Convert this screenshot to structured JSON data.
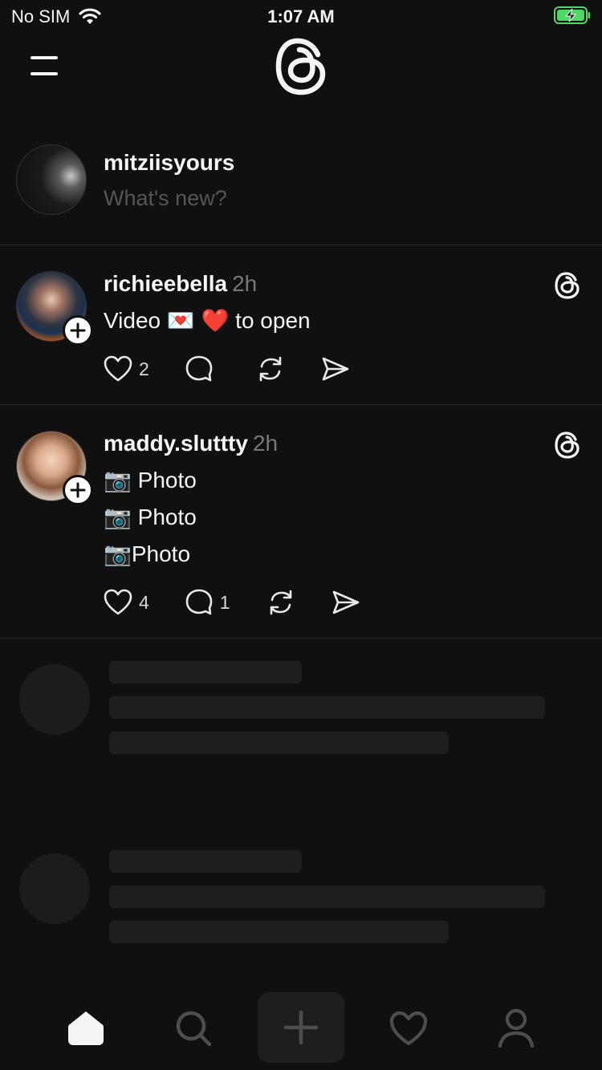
{
  "status_bar": {
    "carrier": "No SIM",
    "time": "1:07 AM"
  },
  "composer": {
    "username": "mitziisyours",
    "placeholder": "What's new?"
  },
  "posts": [
    {
      "username": "richieebella",
      "time": "2h",
      "lines": [
        "Video 💌 ❤️ to open"
      ],
      "likes": "2",
      "replies": ""
    },
    {
      "username": "maddy.sluttty",
      "time": "2h",
      "lines": [
        "📷 Photo",
        "📷 Photo",
        "📷Photo"
      ],
      "likes": "4",
      "replies": "1"
    }
  ],
  "icons": {
    "menu": "menu-icon",
    "logo": "threads-logo",
    "follow": "plus-icon",
    "like": "heart-icon",
    "reply": "comment-icon",
    "repost": "repost-icon",
    "share": "send-icon",
    "tabs": [
      "home-icon",
      "search-icon",
      "plus-icon",
      "heart-icon",
      "profile-icon"
    ]
  },
  "colors": {
    "background": "#101010",
    "text": "#f3f5f7",
    "muted": "#777777",
    "skeleton": "#1e1e1e",
    "battery": "#4cd964"
  }
}
